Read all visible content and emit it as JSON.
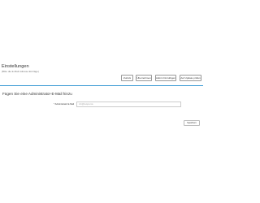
{
  "header": {
    "title": "Einstellungen",
    "subtitle": "(Bitte die E-Mail Adresse Einträge)"
  },
  "toolbar": {
    "back_label": "Zurück",
    "extra_label": "Übernehmen",
    "add_label": "Admin hinzufügen",
    "update_label": "Auf Update prüfen"
  },
  "form": {
    "section_title": "Fügen Sie eine Administrator-E-Mail hinzu",
    "email_label": "* Administrator E-Mail",
    "email_placeholder": "info@beispiel.de"
  },
  "actions": {
    "save_label": "Speichern"
  },
  "colors": {
    "accent": "#3b9bd4"
  }
}
